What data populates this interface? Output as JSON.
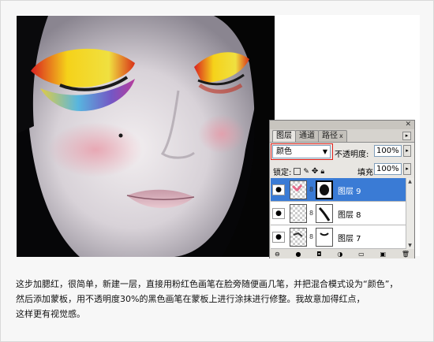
{
  "palette": {
    "close_glyph": "✕",
    "tabs": [
      {
        "label": "图层",
        "active": true
      },
      {
        "label": "通道",
        "active": false
      },
      {
        "label": "路径",
        "active": false
      }
    ],
    "tab_close_glyph": "x",
    "menu_glyph": "▸",
    "blend_mode": "颜色",
    "blend_arrow": "▼",
    "opacity_label": "不透明度:",
    "opacity_value": "100%",
    "lock_label": "锁定:",
    "fill_label": "填充:",
    "fill_value": "100%",
    "spin_arrow": "▸",
    "layers": [
      {
        "name": "图层 9",
        "selected": true
      },
      {
        "name": "图层 8",
        "selected": false
      },
      {
        "name": "图层 7",
        "selected": false
      }
    ],
    "eye_glyph": "●",
    "chain_glyph": "8",
    "footer_icons": [
      "link-icon",
      "fx-icon",
      "mask-icon",
      "adjustment-icon",
      "group-icon",
      "new-layer-icon",
      "trash-icon"
    ],
    "footer_glyphs": [
      "⊖",
      "●",
      "◘",
      "◑",
      "▭",
      "▣",
      "🗑"
    ],
    "scroll_up": "▲",
    "scroll_down": "▼"
  },
  "caption": {
    "line1": "这步加腮红，很简单，新建一层，直接用粉红色画笔在脸旁随便画几笔，并把混合模式设为“颜色”，",
    "line2": "然后添加蒙板，用不透明度30%的黑色画笔在蒙板上进行涂抹进行修整。我故意加得红点，",
    "line3": "这样更有视觉感。"
  },
  "colors": {
    "selection_blue": "#3a7bd5",
    "highlight_red": "#e0201a"
  }
}
